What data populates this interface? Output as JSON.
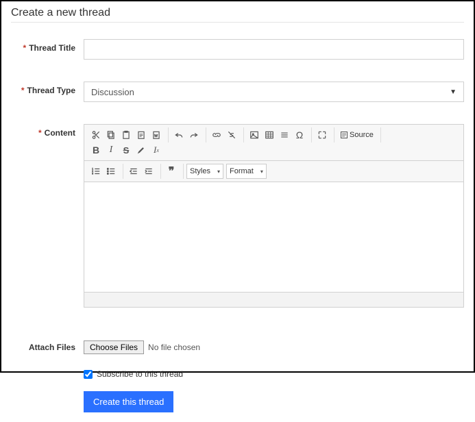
{
  "heading": "Create a new thread",
  "labels": {
    "thread_title": "Thread Title",
    "thread_type": "Thread Type",
    "content": "Content",
    "attach_files": "Attach Files"
  },
  "thread_type": {
    "selected": "Discussion"
  },
  "editor": {
    "source_label": "Source",
    "styles_label": "Styles",
    "format_label": "Format"
  },
  "file": {
    "choose_label": "Choose Files",
    "status": "No file chosen"
  },
  "subscribe": {
    "checked": true,
    "label": "Subscribe to this thread"
  },
  "submit_label": "Create this thread"
}
